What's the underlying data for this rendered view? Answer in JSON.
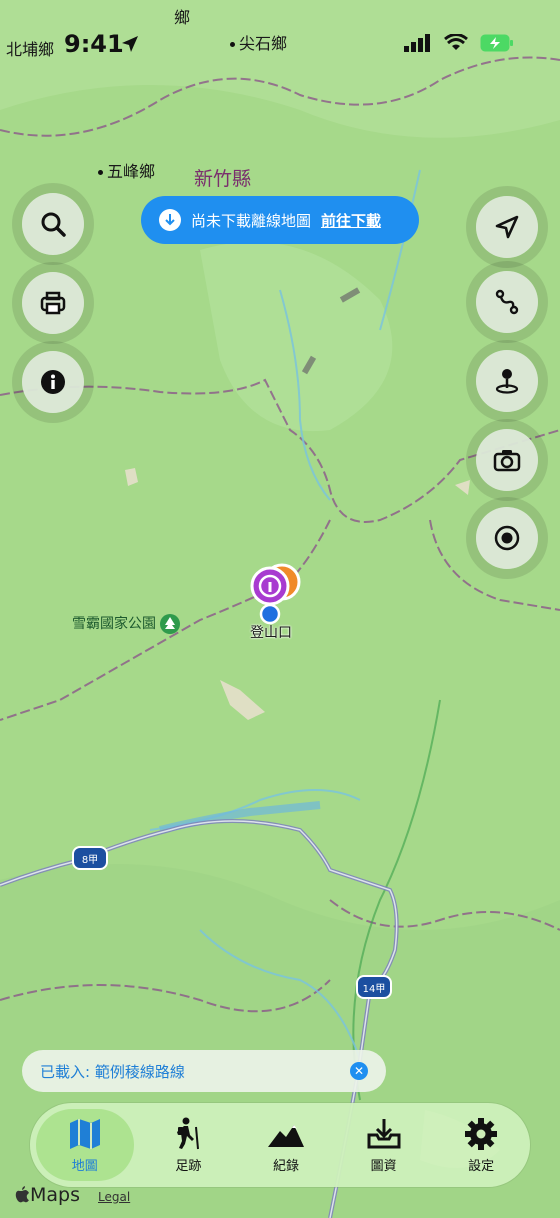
{
  "status_bar": {
    "time": "9:41"
  },
  "places": {
    "north_puli": "北埔鄉",
    "top_partial": "鄉",
    "jianshi": "尖石鄉",
    "wufeng": "五峰鄉",
    "county": "新竹縣",
    "park": "雪霸國家公園"
  },
  "banner": {
    "text": "尚未下載離線地圖",
    "link": "前往下載"
  },
  "pin": {
    "label": "登山口"
  },
  "road_shields": {
    "r8": "8甲",
    "r14": "14甲"
  },
  "loaded_bar": {
    "text": "已載入: 範例稜線路線"
  },
  "tabs": [
    {
      "label": "地圖",
      "icon": "map-icon"
    },
    {
      "label": "足跡",
      "icon": "hiker-icon"
    },
    {
      "label": "紀錄",
      "icon": "mountains-icon"
    },
    {
      "label": "圖資",
      "icon": "download-tray-icon"
    },
    {
      "label": "設定",
      "icon": "gear-icon"
    }
  ],
  "footer": {
    "maps": "Maps",
    "legal": "Legal"
  },
  "colors": {
    "accent": "#1f8ff0",
    "map_green": "#a6d98a",
    "county_border": "#8a4f8a"
  }
}
